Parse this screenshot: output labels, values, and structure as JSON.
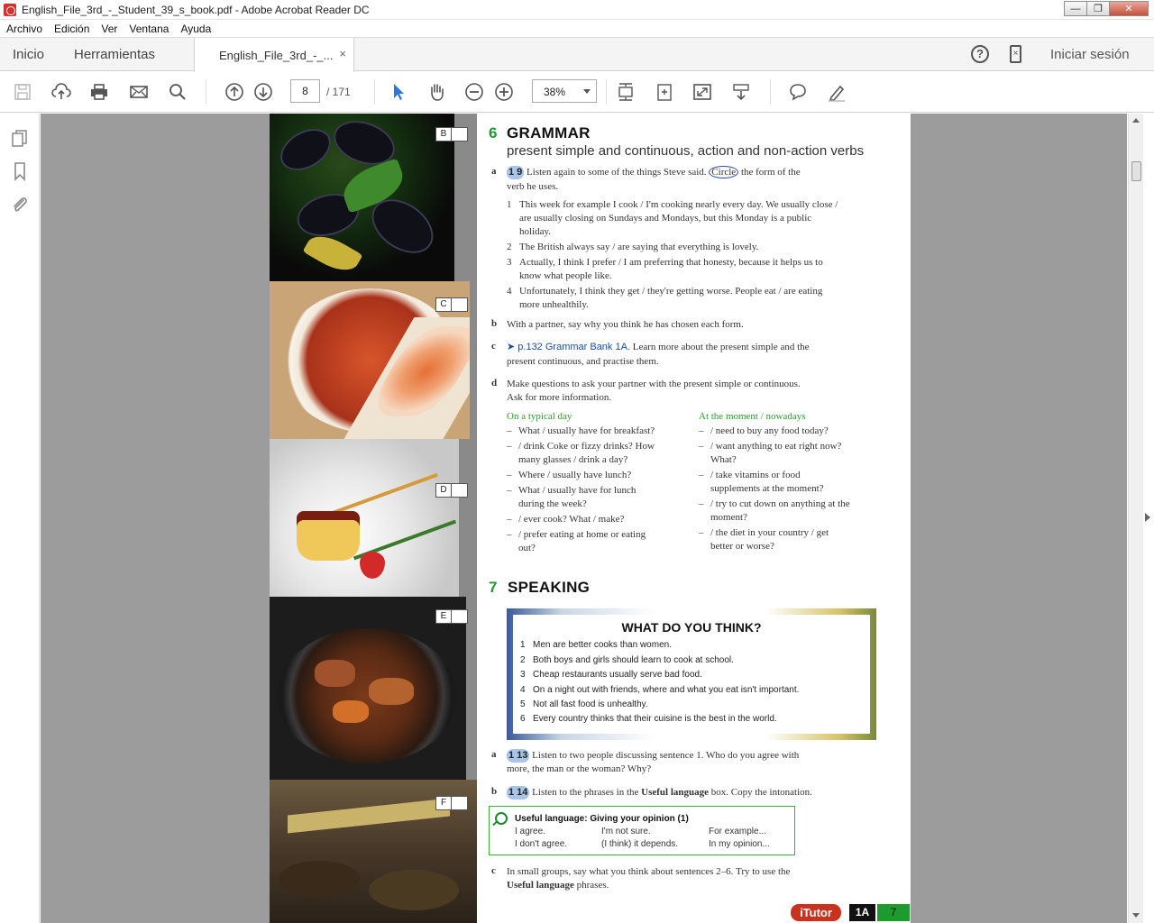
{
  "window": {
    "title": "English_File_3rd_-_Student_39_s_book.pdf - Adobe Acrobat Reader DC",
    "minimize": "—",
    "maximize": "❐",
    "close": "✕"
  },
  "menubar": {
    "items": [
      "Archivo",
      "Edición",
      "Ver",
      "Ventana",
      "Ayuda"
    ]
  },
  "tabs": {
    "home": "Inicio",
    "tools": "Herramientas",
    "document": "English_File_3rd_-_...",
    "close_x": "×",
    "help": "?",
    "signin": "Iniciar sesión"
  },
  "toolbar": {
    "page_current": "8",
    "page_total": "/ 171",
    "zoom": "38%"
  },
  "page": {
    "photo_letters": [
      "B",
      "C",
      "D",
      "E",
      "F"
    ],
    "grammar": {
      "number": "6",
      "title": "GRAMMAR",
      "subtitle": "present simple and continuous, action and non-action verbs",
      "a_label": "a",
      "a_audio": "1 9",
      "a_text_1": "Listen again to some of the things Steve said.",
      "a_circle": "Circle",
      "a_text_2": "the form of the",
      "a_text_3": "verb he uses.",
      "items": [
        {
          "n": "1",
          "lines": [
            "This week for example I cook / I'm cooking nearly every day. We usually close /",
            "are usually closing on Sundays and Mondays, but this Monday is a public",
            "holiday."
          ]
        },
        {
          "n": "2",
          "lines": [
            "The British always say / are saying that everything is lovely."
          ]
        },
        {
          "n": "3",
          "lines": [
            "Actually, I think I prefer / I am preferring that honesty, because it helps us to",
            "know what people like."
          ]
        },
        {
          "n": "4",
          "lines": [
            "Unfortunately, I think they get / they're getting worse. People eat / are eating",
            "more unhealthily."
          ]
        }
      ],
      "b_label": "b",
      "b_text": "With a partner, say why you think he has chosen each form.",
      "c_label": "c",
      "c_link": "➤ p.132 Grammar Bank 1A.",
      "c_text_1": "Learn more about the present simple and the",
      "c_text_2": "present continuous, and practise them.",
      "d_label": "d",
      "d_text_1": "Make questions to ask your partner with the present simple or continuous.",
      "d_text_2": "Ask for more information.",
      "col1_head": "On a typical day",
      "col1": [
        [
          "–",
          "What / usually have for breakfast?"
        ],
        [
          "–",
          "/ drink Coke or fizzy drinks? How"
        ],
        [
          "",
          "many glasses / drink a day?"
        ],
        [
          "–",
          "Where / usually have lunch?"
        ],
        [
          "–",
          "What / usually have for lunch"
        ],
        [
          "",
          "during the week?"
        ],
        [
          "–",
          "/ ever cook? What / make?"
        ],
        [
          "–",
          "/ prefer eating at home or eating"
        ],
        [
          "",
          "out?"
        ]
      ],
      "col2_head": "At the moment / nowadays",
      "col2": [
        [
          "–",
          "/ need to buy any food today?"
        ],
        [
          "–",
          "/ want anything to eat right now?"
        ],
        [
          "",
          "What?"
        ],
        [
          "–",
          "/ take vitamins or food"
        ],
        [
          "",
          "supplements at the moment?"
        ],
        [
          "–",
          "/ try to cut down on anything at the"
        ],
        [
          "",
          "moment?"
        ],
        [
          "–",
          "/ the diet in your country / get"
        ],
        [
          "",
          "better or worse?"
        ]
      ]
    },
    "speaking": {
      "number": "7",
      "title": "SPEAKING",
      "box_title": "WHAT DO YOU THINK?",
      "statements": [
        {
          "n": "1",
          "t": "Men are better cooks than women."
        },
        {
          "n": "2",
          "t": "Both boys and girls should learn to cook at school."
        },
        {
          "n": "3",
          "t": "Cheap restaurants usually serve bad food."
        },
        {
          "n": "4",
          "t": "On a night out with friends, where and what you eat isn't important."
        },
        {
          "n": "5",
          "t": "Not all fast food is unhealthy."
        },
        {
          "n": "6",
          "t": "Every country thinks that their cuisine is the best in the world."
        }
      ],
      "a_label": "a",
      "a_audio": "1 13",
      "a_text_1": "Listen to two people discussing sentence 1. Who do you agree with",
      "a_text_2": "more, the man or the woman? Why?",
      "b_label": "b",
      "b_audio": "1 14",
      "b_text_pre": "Listen to the phrases in the",
      "b_text_bold": "Useful language",
      "b_text_post": "box. Copy the intonation.",
      "useful_title": "Useful language: Giving your opinion (1)",
      "useful": [
        "I agree.",
        "I'm not sure.",
        "For example...",
        "I don't agree.",
        "(I think) it depends.",
        "In my opinion..."
      ],
      "c_label": "c",
      "c_text_1": "In small groups, say what you think about sentences 2–6. Try to use the",
      "c_text_bold": "Useful language",
      "c_text_2": "phrases."
    },
    "footer": {
      "itutor": "iTutor",
      "unit": "1A",
      "page_number": "7"
    }
  }
}
